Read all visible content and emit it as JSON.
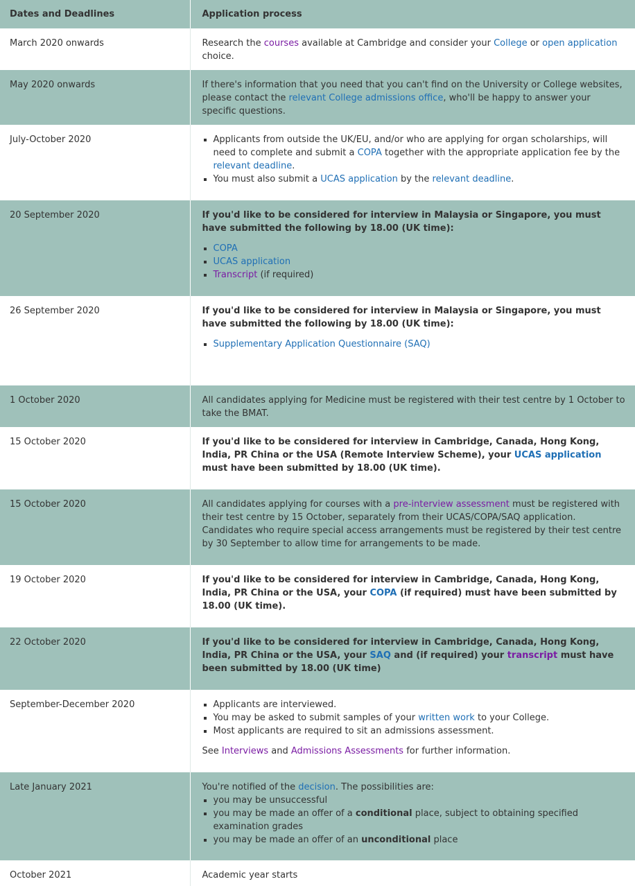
{
  "header": {
    "col1": "Dates and Deadlines",
    "col2": "Application process"
  },
  "rows": [
    {
      "date": "March 2020 onwards",
      "t1": "Research the ",
      "l1": "courses",
      "t2": " available at Cambridge and consider your ",
      "l2": "College",
      "t3": " or ",
      "l3": "open application",
      "t4": " choice."
    },
    {
      "date": "May 2020 onwards",
      "t1": "If there's information that you need that you can't find on the University or College websites, please contact the ",
      "l1": "relevant College admissions office",
      "t2": ", who'll be happy to answer your specific questions."
    },
    {
      "date": "July-October 2020",
      "b1": {
        "t1": "Applicants from outside the UK/EU, and/or who are applying for organ scholarships, will need to complete and submit a ",
        "l1": "COPA",
        "t2": " together with the appropriate application fee by the ",
        "l2": "relevant deadline",
        "t3": "."
      },
      "b2": {
        "t1": "You must also submit a ",
        "l1": "UCAS application",
        "t2": " by the ",
        "l2": "relevant deadline",
        "t3": "."
      }
    },
    {
      "date": "20 September 2020",
      "heading": "If you'd like to be considered for interview in Malaysia or Singapore, you must have submitted the following by 18.00 (UK time):",
      "items": [
        "COPA",
        "UCAS application",
        "Transcript"
      ],
      "note": " (if required)"
    },
    {
      "date": "26 September 2020",
      "heading": "If you'd like to be considered for interview in Malaysia or Singapore, you must have submitted the following by 18.00 (UK time):",
      "items": [
        "Supplementary Application Questionnaire (SAQ)"
      ]
    },
    {
      "date": "1 October 2020",
      "text": "All candidates applying for Medicine must be registered with their test centre by 1 October to take the BMAT."
    },
    {
      "date": "15 October 2020",
      "t1": "If you'd like to be considered for interview in Cambridge, Canada, Hong Kong, India, PR China or the USA (Remote Interview Scheme), your ",
      "l1": "UCAS application",
      "t2": " must have been submitted by 18.00 (UK time)."
    },
    {
      "date": "15 October 2020",
      "t1": "All candidates applying for courses with a ",
      "l1": "pre-interview assessment",
      "t2": " must be registered with their test centre by 15 October, separately from their UCAS/COPA/SAQ application. Candidates who require special access arrangements must be registered by their test centre by 30 September to allow time for arrangements to be made."
    },
    {
      "date": "19 October 2020",
      "t1": "If you'd like to be considered for interview in Cambridge, Canada, Hong Kong, India, PR China or the USA",
      "t2": ", your ",
      "l1": "COPA",
      "t3": " (if required) must have been submitted by 18.00 (UK time)."
    },
    {
      "date": "22 October 2020",
      "t1": "If you'd like to be considered for interview in Cambridge, Canada, Hong Kong, India, PR China or the USA, your ",
      "l1": "SAQ",
      "t2": " and (if required) your ",
      "l2": "transcript",
      "t3": " must have been submitted by 18.00 (UK time)"
    },
    {
      "date": "September-December 2020",
      "b1": "Applicants are interviewed.",
      "b2": {
        "t1": "You may be asked to submit samples of your ",
        "l1": "written work",
        "t2": " to your College."
      },
      "b3": "Most applicants are required to sit an admissions assessment.",
      "p": {
        "t1": "See ",
        "l1": "Interviews",
        "t2": " and ",
        "l2": "Admissions Assessments",
        "t3": " for further information."
      }
    },
    {
      "date": "Late January 2021",
      "intro": {
        "t1": "You're notified of the ",
        "l1": "decision",
        "t2": ". The possibilities are:"
      },
      "b1": "you may be unsuccessful",
      "b2": {
        "t1": "you may be made an offer of a ",
        "s1": "conditional",
        "t2": " place, subject to obtaining specified examination grades"
      },
      "b3": {
        "t1": "you may be made an offer of an ",
        "s1": "unconditional",
        "t2": " place"
      }
    },
    {
      "date": "October 2021",
      "text": "Academic year starts"
    }
  ]
}
